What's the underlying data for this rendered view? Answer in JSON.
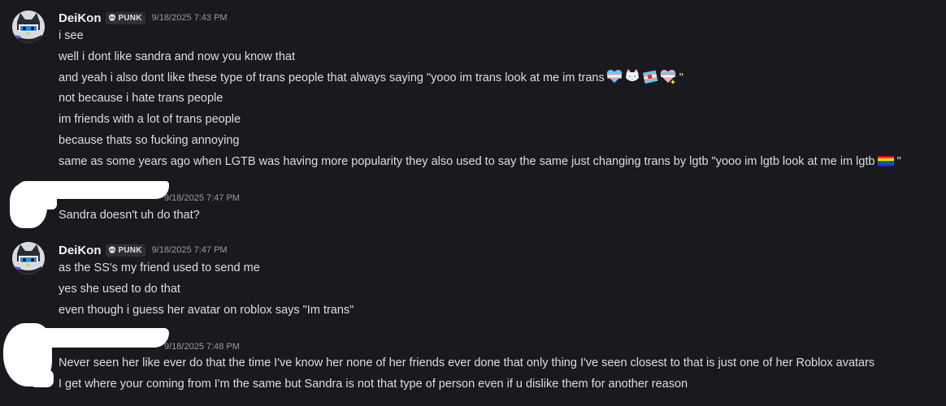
{
  "messages": [
    {
      "author": "DeiKon",
      "tag": "PUNK",
      "tag_icon": "skull-icon",
      "timestamp": "9/18/2025 7:43 PM",
      "lines": [
        "i see",
        "well i dont like sandra and now you know that",
        "and yeah i also dont like these type of trans people that always saying \"yooo im trans look at me im trans",
        "not because i hate trans people",
        "im friends with a lot of trans people",
        "because thats so fucking annoying",
        "same as some years ago when LGTB was having more popularity they also used to say the same just changing trans by lgtb \"yooo im lgtb look at me im lgtb"
      ],
      "line3_emojis": [
        "trans-heart-emoji",
        "trans-cat-emoji",
        "trans-flag-emoji",
        "trans-sparkle-heart-emoji"
      ],
      "line3_end": " \"",
      "line7_emoji": "rainbow-flag-emoji",
      "line7_end": " \""
    },
    {
      "author": "",
      "timestamp": "9/18/2025 7:47 PM",
      "lines": [
        "Sandra doesn't uh do that?"
      ]
    },
    {
      "author": "DeiKon",
      "tag": "PUNK",
      "tag_icon": "skull-icon",
      "timestamp": "9/18/2025 7:47 PM",
      "lines": [
        "as the SS's my friend used to send me",
        "yes she used to do that",
        "even though i guess her avatar on roblox says \"Im trans\""
      ]
    },
    {
      "author": "",
      "timestamp": "9/18/2025 7:48 PM",
      "lines": [
        "Never seen her like ever do that the time I've know her none of her friends ever done that only thing I've seen closest to that is just one of her Roblox avatars",
        "I get where your coming from I'm the same but Sandra is not that type of person even if u dislike them for another reason"
      ]
    }
  ],
  "colors": {
    "background": "#1a1a1e",
    "text": "#dbdee1",
    "username": "#f2f3f5",
    "timestamp": "#949ba4",
    "redaction": "#ffffff"
  }
}
